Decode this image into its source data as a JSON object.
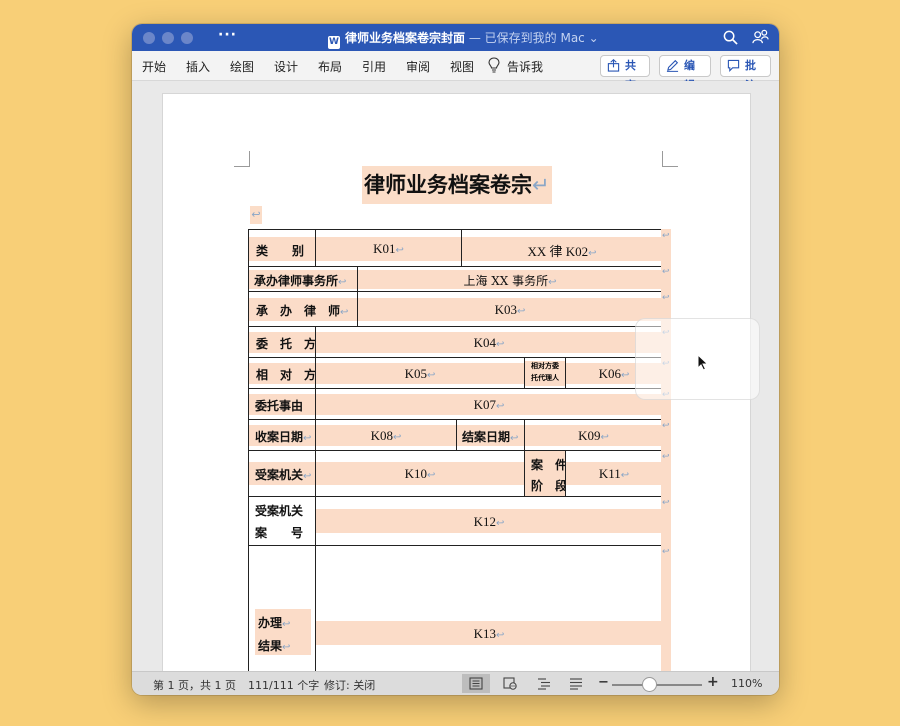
{
  "window": {
    "doc_icon": "W",
    "doc_title": "律师业务档案卷宗封面",
    "save_status": " — 已保存到我的 Mac",
    "icons": {
      "search": "search-icon",
      "share_people": "people-icon"
    }
  },
  "ribbon": {
    "tabs": [
      "开始",
      "插入",
      "绘图",
      "设计",
      "布局",
      "引用",
      "审阅",
      "视图"
    ],
    "tell_me": "告诉我",
    "share_label": "共享",
    "edit_label": "编辑",
    "comment_label": "批注"
  },
  "document": {
    "heading": "律师业务档案卷宗",
    "paragraph_mark": "↵",
    "cell_mark": "↩",
    "form": {
      "category_label": "类　　别",
      "category_value_1": "K01",
      "category_value_2": "XX 律 K02",
      "firm_label": "承办律师事务所",
      "firm_value": "上海 XX 事务所",
      "lawyer_label": "承　办　律　师",
      "lawyer_value": "K03",
      "client_label": "委　托　方",
      "client_value": "K04",
      "opponent_label": "相　对　方",
      "opponent_value": "K05",
      "opponent_agent_label_1": "相对方委",
      "opponent_agent_label_2": "托代理人",
      "opponent_agent_value": "K06",
      "matter_label": "委托事由",
      "matter_value": "K07",
      "accept_date_label": "收案日期",
      "accept_date_value": "K08",
      "close_date_label": "结案日期",
      "close_date_value": "K09",
      "authority_label": "受案机关",
      "authority_value": "K10",
      "stage_label_1": "案　件",
      "stage_label_2": "阶　段",
      "stage_value": "K11",
      "case_no_label_1": "受案机关",
      "case_no_label_2": "案　　号",
      "case_no_value": "K12",
      "result_label_1": "办理",
      "result_label_2": "结果",
      "result_value": "K13"
    }
  },
  "status": {
    "page": "第 1 页，共 1 页",
    "words": "111/111 个字",
    "track_changes": "修订: 关闭",
    "zoom": "110%",
    "zoom_fraction": 0.42
  },
  "colors": {
    "title_bar": "#2b57b5",
    "highlight": "#fbdcc8",
    "desktop": "#f8cf77"
  }
}
